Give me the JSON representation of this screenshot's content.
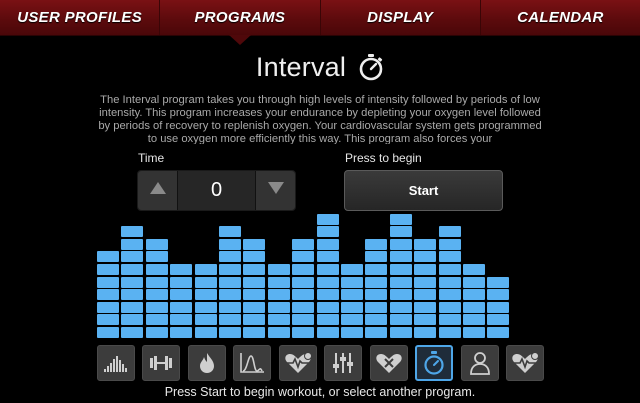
{
  "nav": {
    "items": [
      {
        "label": "USER PROFILES",
        "active": false
      },
      {
        "label": "PROGRAMS",
        "active": true
      },
      {
        "label": "DISPLAY",
        "active": false
      },
      {
        "label": "CALENDAR",
        "active": false
      }
    ]
  },
  "program": {
    "title": "Interval",
    "description": "The Interval program takes you through high levels of intensity followed by periods of low intensity. This program increases your endurance by depleting your oxygen level followed by periods of recovery to replenish oxygen. Your cardiovascular system gets programmed to use oxygen more efficiently this way. This program also forces your"
  },
  "time": {
    "label": "Time",
    "value": "0"
  },
  "start": {
    "label": "Press to begin",
    "button": "Start"
  },
  "profile_levels": [
    7,
    9,
    8,
    6,
    6,
    9,
    8,
    6,
    8,
    10,
    6,
    8,
    10,
    8,
    9,
    6,
    5
  ],
  "profile_color": "#5ab2f2",
  "programs": [
    {
      "icon": "hill-icon",
      "active": false
    },
    {
      "icon": "dumbbell-icon",
      "active": false
    },
    {
      "icon": "flame-icon",
      "active": false
    },
    {
      "icon": "peak-chart-icon",
      "active": false
    },
    {
      "icon": "heart-rate-icon",
      "active": false
    },
    {
      "icon": "custom-sliders-icon",
      "active": false
    },
    {
      "icon": "heart-x-icon",
      "active": false
    },
    {
      "icon": "stopwatch-icon",
      "active": true
    },
    {
      "icon": "user-icon",
      "active": false
    },
    {
      "icon": "heart-rate-plus-icon",
      "active": false
    }
  ],
  "footer": {
    "text": "Press Start to begin workout, or select another program."
  }
}
